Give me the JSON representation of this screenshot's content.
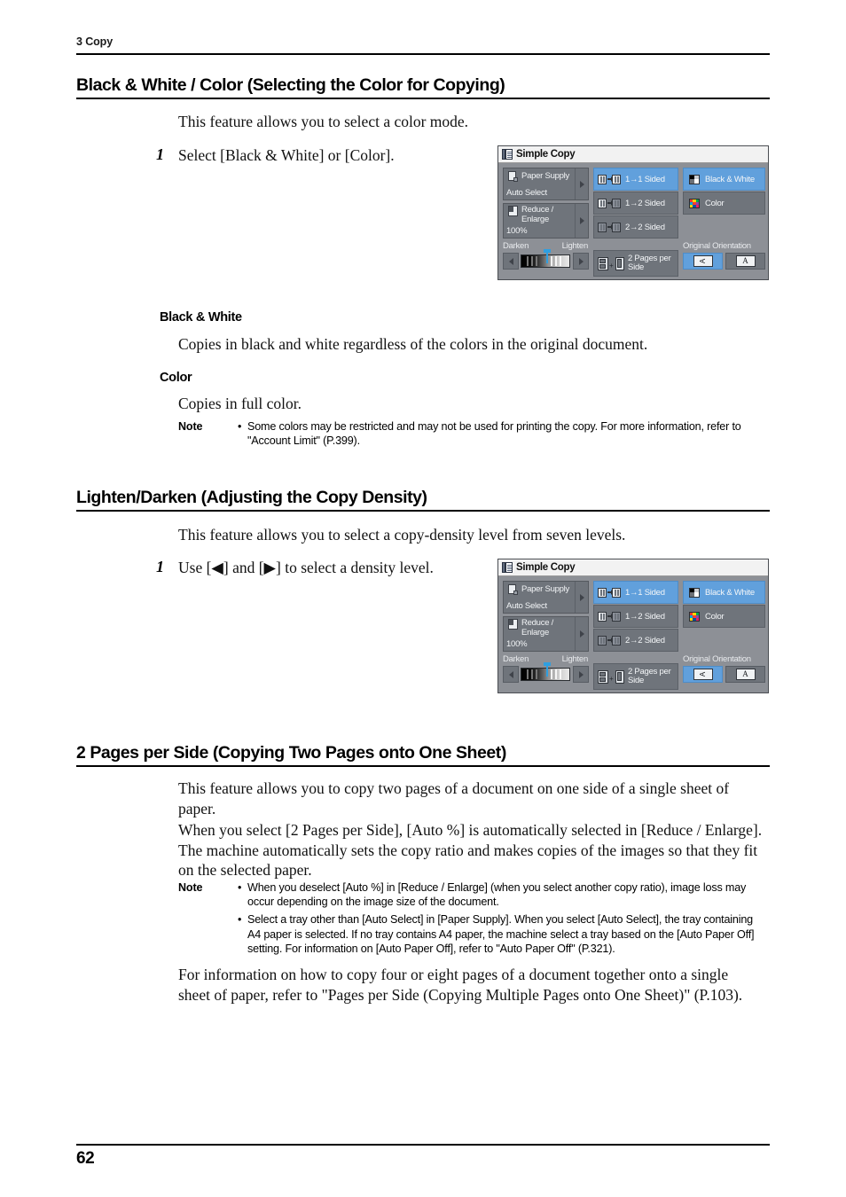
{
  "running_head": "3 Copy",
  "page_number": "62",
  "sections": [
    {
      "heading": "Black & White / Color (Selecting the Color for Copying)",
      "intro": "This feature allows you to select a color mode.",
      "step_number": "1",
      "step_text": "Select [Black & White] or [Color].",
      "sub1_heading": "Black & White",
      "sub1_text": "Copies in black and white regardless of the colors in the original document.",
      "sub2_heading": "Color",
      "sub2_text": "Copies in full color.",
      "note_label": "Note",
      "note_items": [
        "Some colors may be restricted and may not be used for printing the copy. For more information, refer to \"Account Limit\" (P.399)."
      ]
    },
    {
      "heading": "Lighten/Darken (Adjusting the Copy Density)",
      "intro": "This feature allows you to select a copy-density level from seven levels.",
      "step_number": "1",
      "step_text": "Use [◀] and [▶] to select a density level."
    },
    {
      "heading": "2 Pages per Side (Copying Two Pages onto One Sheet)",
      "para1": "This feature allows you to copy two pages of a document on one side of a single sheet of paper.",
      "para2": "When you select [2 Pages per Side], [Auto %] is automatically selected in [Reduce / Enlarge]. The machine automatically sets the copy ratio and makes copies of the images so that they fit on the selected paper.",
      "note_label": "Note",
      "note_items": [
        "When you deselect [Auto %] in [Reduce / Enlarge] (when you select another copy ratio), image loss may occur depending on the image size of the document.",
        "Select a tray other than [Auto Select] in [Paper Supply]. When you select [Auto Select], the tray containing A4 paper is selected. If no tray contains A4 paper, the machine select a tray based on the [Auto Paper Off] setting. For information on [Auto Paper Off], refer to \"Auto Paper Off\" (P.321)."
      ],
      "para3": "For information on how to copy four or eight pages of a document together onto a single sheet of paper, refer to \"Pages per Side (Copying Multiple Pages onto One Sheet)\" (P.103)."
    }
  ],
  "ui_panel": {
    "title": "Simple Copy",
    "paper_supply": {
      "label": "Paper Supply",
      "value": "Auto Select"
    },
    "reduce_enlarge": {
      "label": "Reduce /\nEnlarge",
      "label_line1": "Reduce /",
      "label_line2": "Enlarge",
      "value": "100%"
    },
    "sided_options": [
      {
        "label": "1→1 Sided",
        "selected": true
      },
      {
        "label": "1→2 Sided",
        "selected": false
      },
      {
        "label": "2→2 Sided",
        "selected": false
      }
    ],
    "color_options": [
      {
        "label": "Black & White",
        "selected": true
      },
      {
        "label": "Color",
        "selected": false
      }
    ],
    "density": {
      "darken_label": "Darken",
      "lighten_label": "Lighten",
      "level": 4,
      "levels": 7
    },
    "pages_per_side": {
      "label_line1": "2 Pages per",
      "label_line2": "Side"
    },
    "original_orientation": {
      "label": "Original Orientation",
      "options": [
        {
          "glyph": "A",
          "rotated": true,
          "selected": true
        },
        {
          "glyph": "A",
          "rotated": false,
          "selected": false
        }
      ]
    },
    "colors": {
      "panel_bg": "#8d9096",
      "button_bg": "#6f747b",
      "selected_blue": "#61a0dc",
      "titlebar_bg": "#f2f2f2",
      "text": "#f4f6f8"
    }
  }
}
